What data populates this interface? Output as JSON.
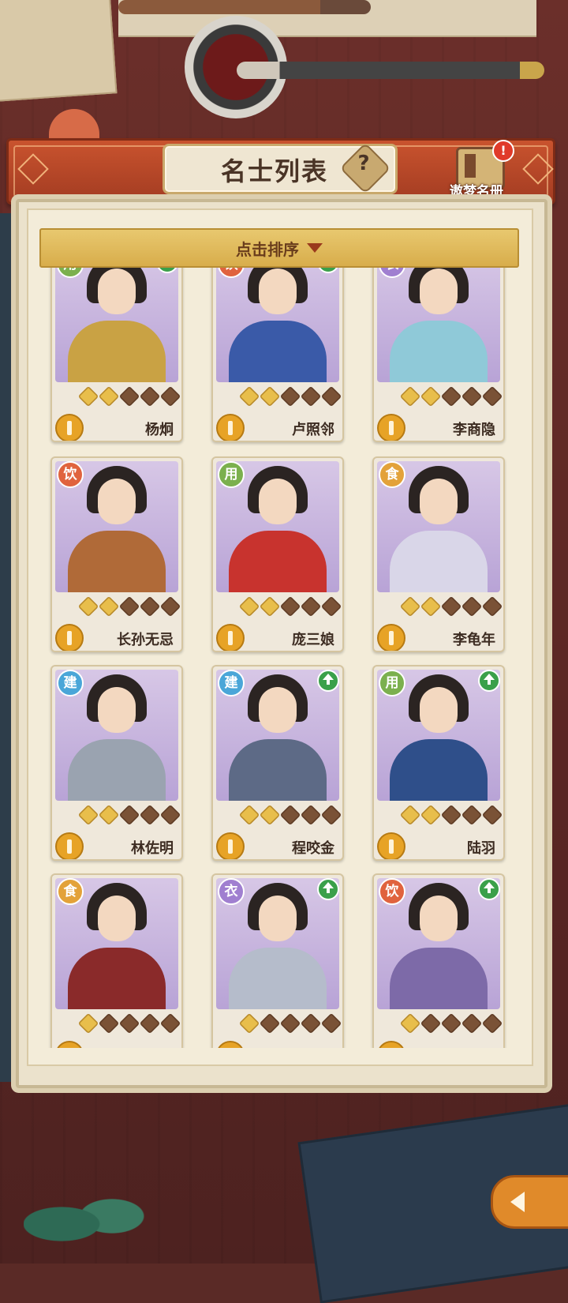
{
  "header": {
    "title": "名士列表",
    "help_symbol": "?",
    "book_label": "遨梦名册",
    "book_notify": "!"
  },
  "sort": {
    "label": "点击排序"
  },
  "cards": [
    {
      "name": "杨炯",
      "tag": "用",
      "stars": 2,
      "upgrade": true,
      "tagColor": "#7bb04e",
      "outfit": "#c9a244"
    },
    {
      "name": "卢照邻",
      "tag": "饮",
      "stars": 2,
      "upgrade": true,
      "tagColor": "#e0633e",
      "outfit": "#3a5aa8"
    },
    {
      "name": "李商隐",
      "tag": "衣",
      "stars": 2,
      "upgrade": false,
      "tagColor": "#a07fd0",
      "outfit": "#8fc9d8"
    },
    {
      "name": "长孙无忌",
      "tag": "饮",
      "stars": 2,
      "upgrade": false,
      "tagColor": "#e0633e",
      "outfit": "#b06a38"
    },
    {
      "name": "庞三娘",
      "tag": "用",
      "stars": 2,
      "upgrade": false,
      "tagColor": "#7bb04e",
      "outfit": "#c8332e"
    },
    {
      "name": "李龟年",
      "tag": "食",
      "stars": 2,
      "upgrade": false,
      "tagColor": "#e3a23a",
      "outfit": "#d9d6e8"
    },
    {
      "name": "林佐明",
      "tag": "建",
      "stars": 2,
      "upgrade": false,
      "tagColor": "#4aa6d8",
      "outfit": "#9aa3b0"
    },
    {
      "name": "程咬金",
      "tag": "建",
      "stars": 2,
      "upgrade": true,
      "tagColor": "#4aa6d8",
      "outfit": "#5d6a86"
    },
    {
      "name": "陆羽",
      "tag": "用",
      "stars": 2,
      "upgrade": true,
      "tagColor": "#7bb04e",
      "outfit": "#2f4f8a"
    },
    {
      "name": "",
      "tag": "食",
      "stars": 1,
      "upgrade": false,
      "tagColor": "#e3a23a",
      "outfit": "#8a2a2a"
    },
    {
      "name": "",
      "tag": "衣",
      "stars": 1,
      "upgrade": true,
      "tagColor": "#a07fd0",
      "outfit": "#b5bccb"
    },
    {
      "name": "",
      "tag": "饮",
      "stars": 1,
      "upgrade": true,
      "tagColor": "#e0633e",
      "outfit": "#7d6aa8"
    }
  ]
}
